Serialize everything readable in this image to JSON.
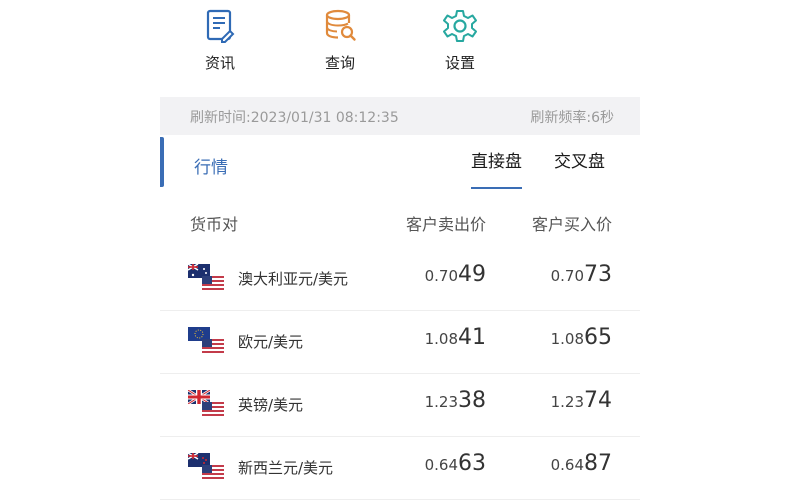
{
  "nav": {
    "items": [
      {
        "label": "资讯",
        "icon": "news-icon",
        "color": "#2f6ab5"
      },
      {
        "label": "查询",
        "icon": "database-search-icon",
        "color": "#e08a3c"
      },
      {
        "label": "设置",
        "icon": "gear-icon",
        "color": "#27a8a0"
      }
    ]
  },
  "refresh": {
    "time_text": "刷新时间:2023/01/31 08:12:35",
    "freq_text": "刷新频率:6秒"
  },
  "tabs": {
    "market_label": "行情",
    "direct_label": "直接盘",
    "cross_label": "交叉盘",
    "active": "直接盘"
  },
  "table": {
    "headers": {
      "pair": "货币对",
      "sell": "客户卖出价",
      "buy": "客户买入价"
    },
    "rows": [
      {
        "pair": "澳大利亚元/美元",
        "flag": "AUD",
        "sell_head": "0.70",
        "sell_tail": "49",
        "buy_head": "0.70",
        "buy_tail": "73"
      },
      {
        "pair": "欧元/美元",
        "flag": "EUR",
        "sell_head": "1.08",
        "sell_tail": "41",
        "buy_head": "1.08",
        "buy_tail": "65"
      },
      {
        "pair": "英镑/美元",
        "flag": "GBP",
        "sell_head": "1.23",
        "sell_tail": "38",
        "buy_head": "1.23",
        "buy_tail": "74"
      },
      {
        "pair": "新西兰元/美元",
        "flag": "NZD",
        "sell_head": "0.64",
        "sell_tail": "63",
        "buy_head": "0.64",
        "buy_tail": "87"
      }
    ]
  },
  "colors": {
    "accent": "#3a6db5",
    "muted": "#9a9a9a",
    "band": "#f2f2f4"
  }
}
